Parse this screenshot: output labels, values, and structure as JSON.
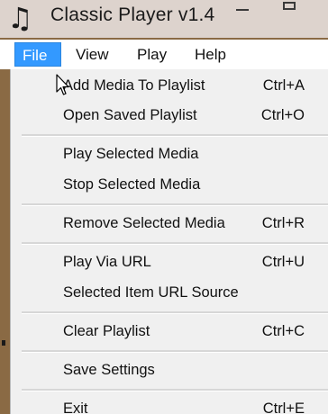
{
  "window": {
    "title": "Classic Player v1.4",
    "icon": "music-note-icon"
  },
  "menubar": {
    "items": [
      {
        "label": "File",
        "active": true
      },
      {
        "label": "View",
        "active": false
      },
      {
        "label": "Play",
        "active": false
      },
      {
        "label": "Help",
        "active": false
      }
    ]
  },
  "dropdown": {
    "items": [
      {
        "label": "Add Media To Playlist",
        "shortcut": "Ctrl+A"
      },
      {
        "label": "Open Saved Playlist",
        "shortcut": "Ctrl+O"
      },
      {
        "label": "Play Selected Media",
        "shortcut": ""
      },
      {
        "label": "Stop Selected Media",
        "shortcut": ""
      },
      {
        "label": "Remove Selected Media",
        "shortcut": "Ctrl+R"
      },
      {
        "label": "Play Via URL",
        "shortcut": "Ctrl+U"
      },
      {
        "label": "Selected Item URL Source",
        "shortcut": ""
      },
      {
        "label": "Clear Playlist",
        "shortcut": "Ctrl+C"
      },
      {
        "label": "Save Settings",
        "shortcut": ""
      },
      {
        "label": "Exit",
        "shortcut": "Ctrl+E"
      }
    ]
  },
  "colors": {
    "highlight": "#3399ff",
    "menu_bg": "#f0f0f0",
    "titlebar_bg": "#ddd3cd"
  }
}
